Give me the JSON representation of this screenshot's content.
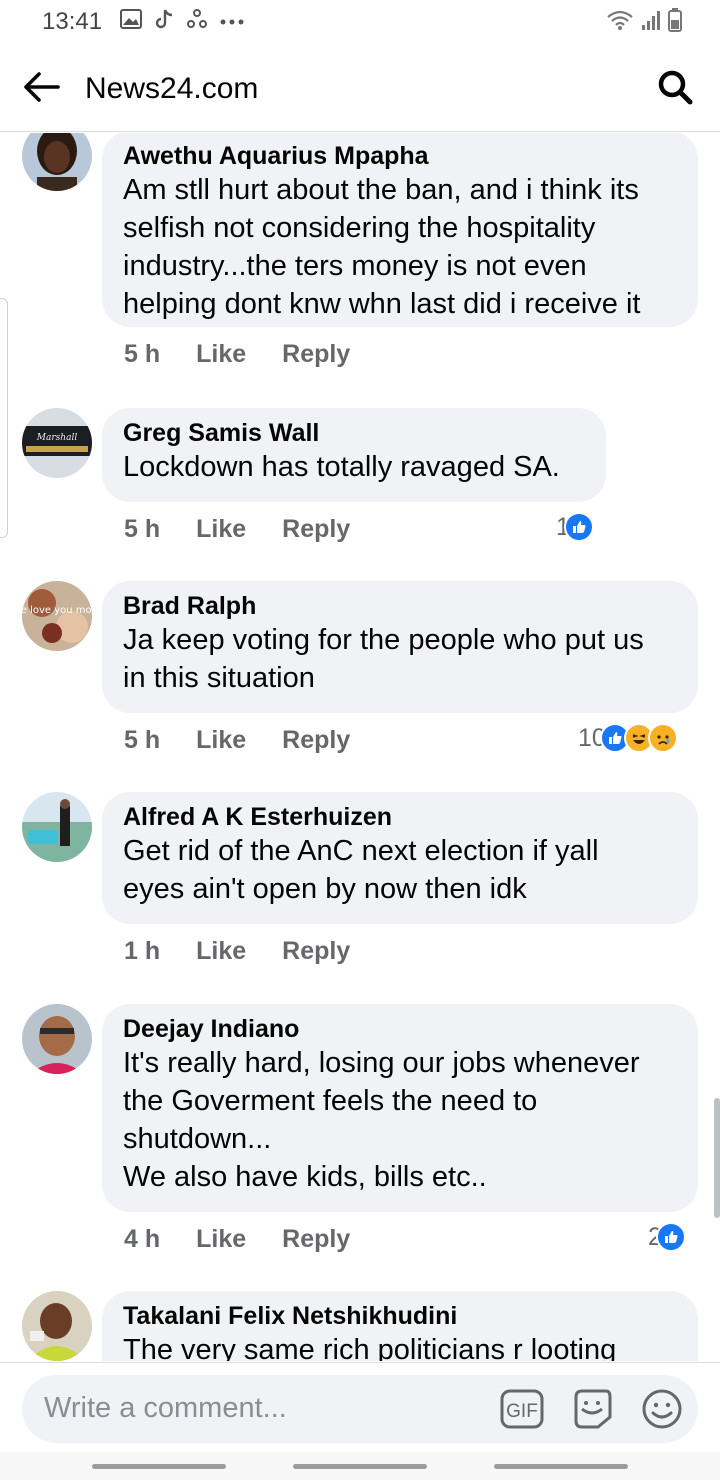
{
  "status_bar": {
    "time": "13:41",
    "left_icons": [
      "gallery-icon",
      "tiktok-icon",
      "sync-icon",
      "more-dots-icon"
    ],
    "right_icons": [
      "wifi-icon",
      "signal-icon",
      "battery-icon"
    ]
  },
  "app_bar": {
    "title": "News24.com",
    "back_icon": "arrow-left-icon",
    "search_icon": "search-icon"
  },
  "comments": [
    {
      "author": "Awethu Aquarius Mpapha",
      "text": "Am stll hurt about the ban, and i think its\nselfish not considering the hospitality\nindustry...the ters money is not even\nhelping dont knw whn last did i receive it",
      "time": "5 h",
      "like": "Like",
      "reply": "Reply",
      "reaction_count": "",
      "reactions": []
    },
    {
      "author": "Greg Samis Wall",
      "text": "Lockdown has totally ravaged SA.",
      "avatar_text": "Marshall",
      "time": "5 h",
      "like": "Like",
      "reply": "Reply",
      "reaction_count": "1",
      "reactions": [
        "like"
      ]
    },
    {
      "author": "Brad Ralph",
      "text": "Ja keep voting for the people who put us\nin this situation",
      "avatar_text": "we love you mom",
      "time": "5 h",
      "like": "Like",
      "reply": "Reply",
      "reaction_count": "10",
      "reactions": [
        "like",
        "haha",
        "sad"
      ]
    },
    {
      "author": "Alfred A K Esterhuizen",
      "text": "Get rid of the AnC next election if yall\neyes ain't open by now then idk",
      "time": "1 h",
      "like": "Like",
      "reply": "Reply",
      "reaction_count": "",
      "reactions": []
    },
    {
      "author": "Deejay Indiano",
      "text": "It's really hard, losing our jobs whenever\nthe Goverment feels the need to\nshutdown...\nWe also have kids, bills etc..",
      "time": "4 h",
      "like": "Like",
      "reply": "Reply",
      "reaction_count": "2",
      "reactions": [
        "like"
      ]
    },
    {
      "author": "Takalani Felix Netshikhudini",
      "text": "The very same rich politicians r looting",
      "time": "",
      "like": "",
      "reply": "",
      "reaction_count": "",
      "reactions": []
    }
  ],
  "composer": {
    "placeholder": "Write a comment...",
    "gif_label": "GIF",
    "sticker_icon": "sticker-icon",
    "emoji_icon": "emoji-icon"
  },
  "colors": {
    "bubble": "#f0f2f5",
    "meta_text": "#65676b",
    "like_blue": "#1877f2",
    "haha_yellow": "#f7b125"
  }
}
